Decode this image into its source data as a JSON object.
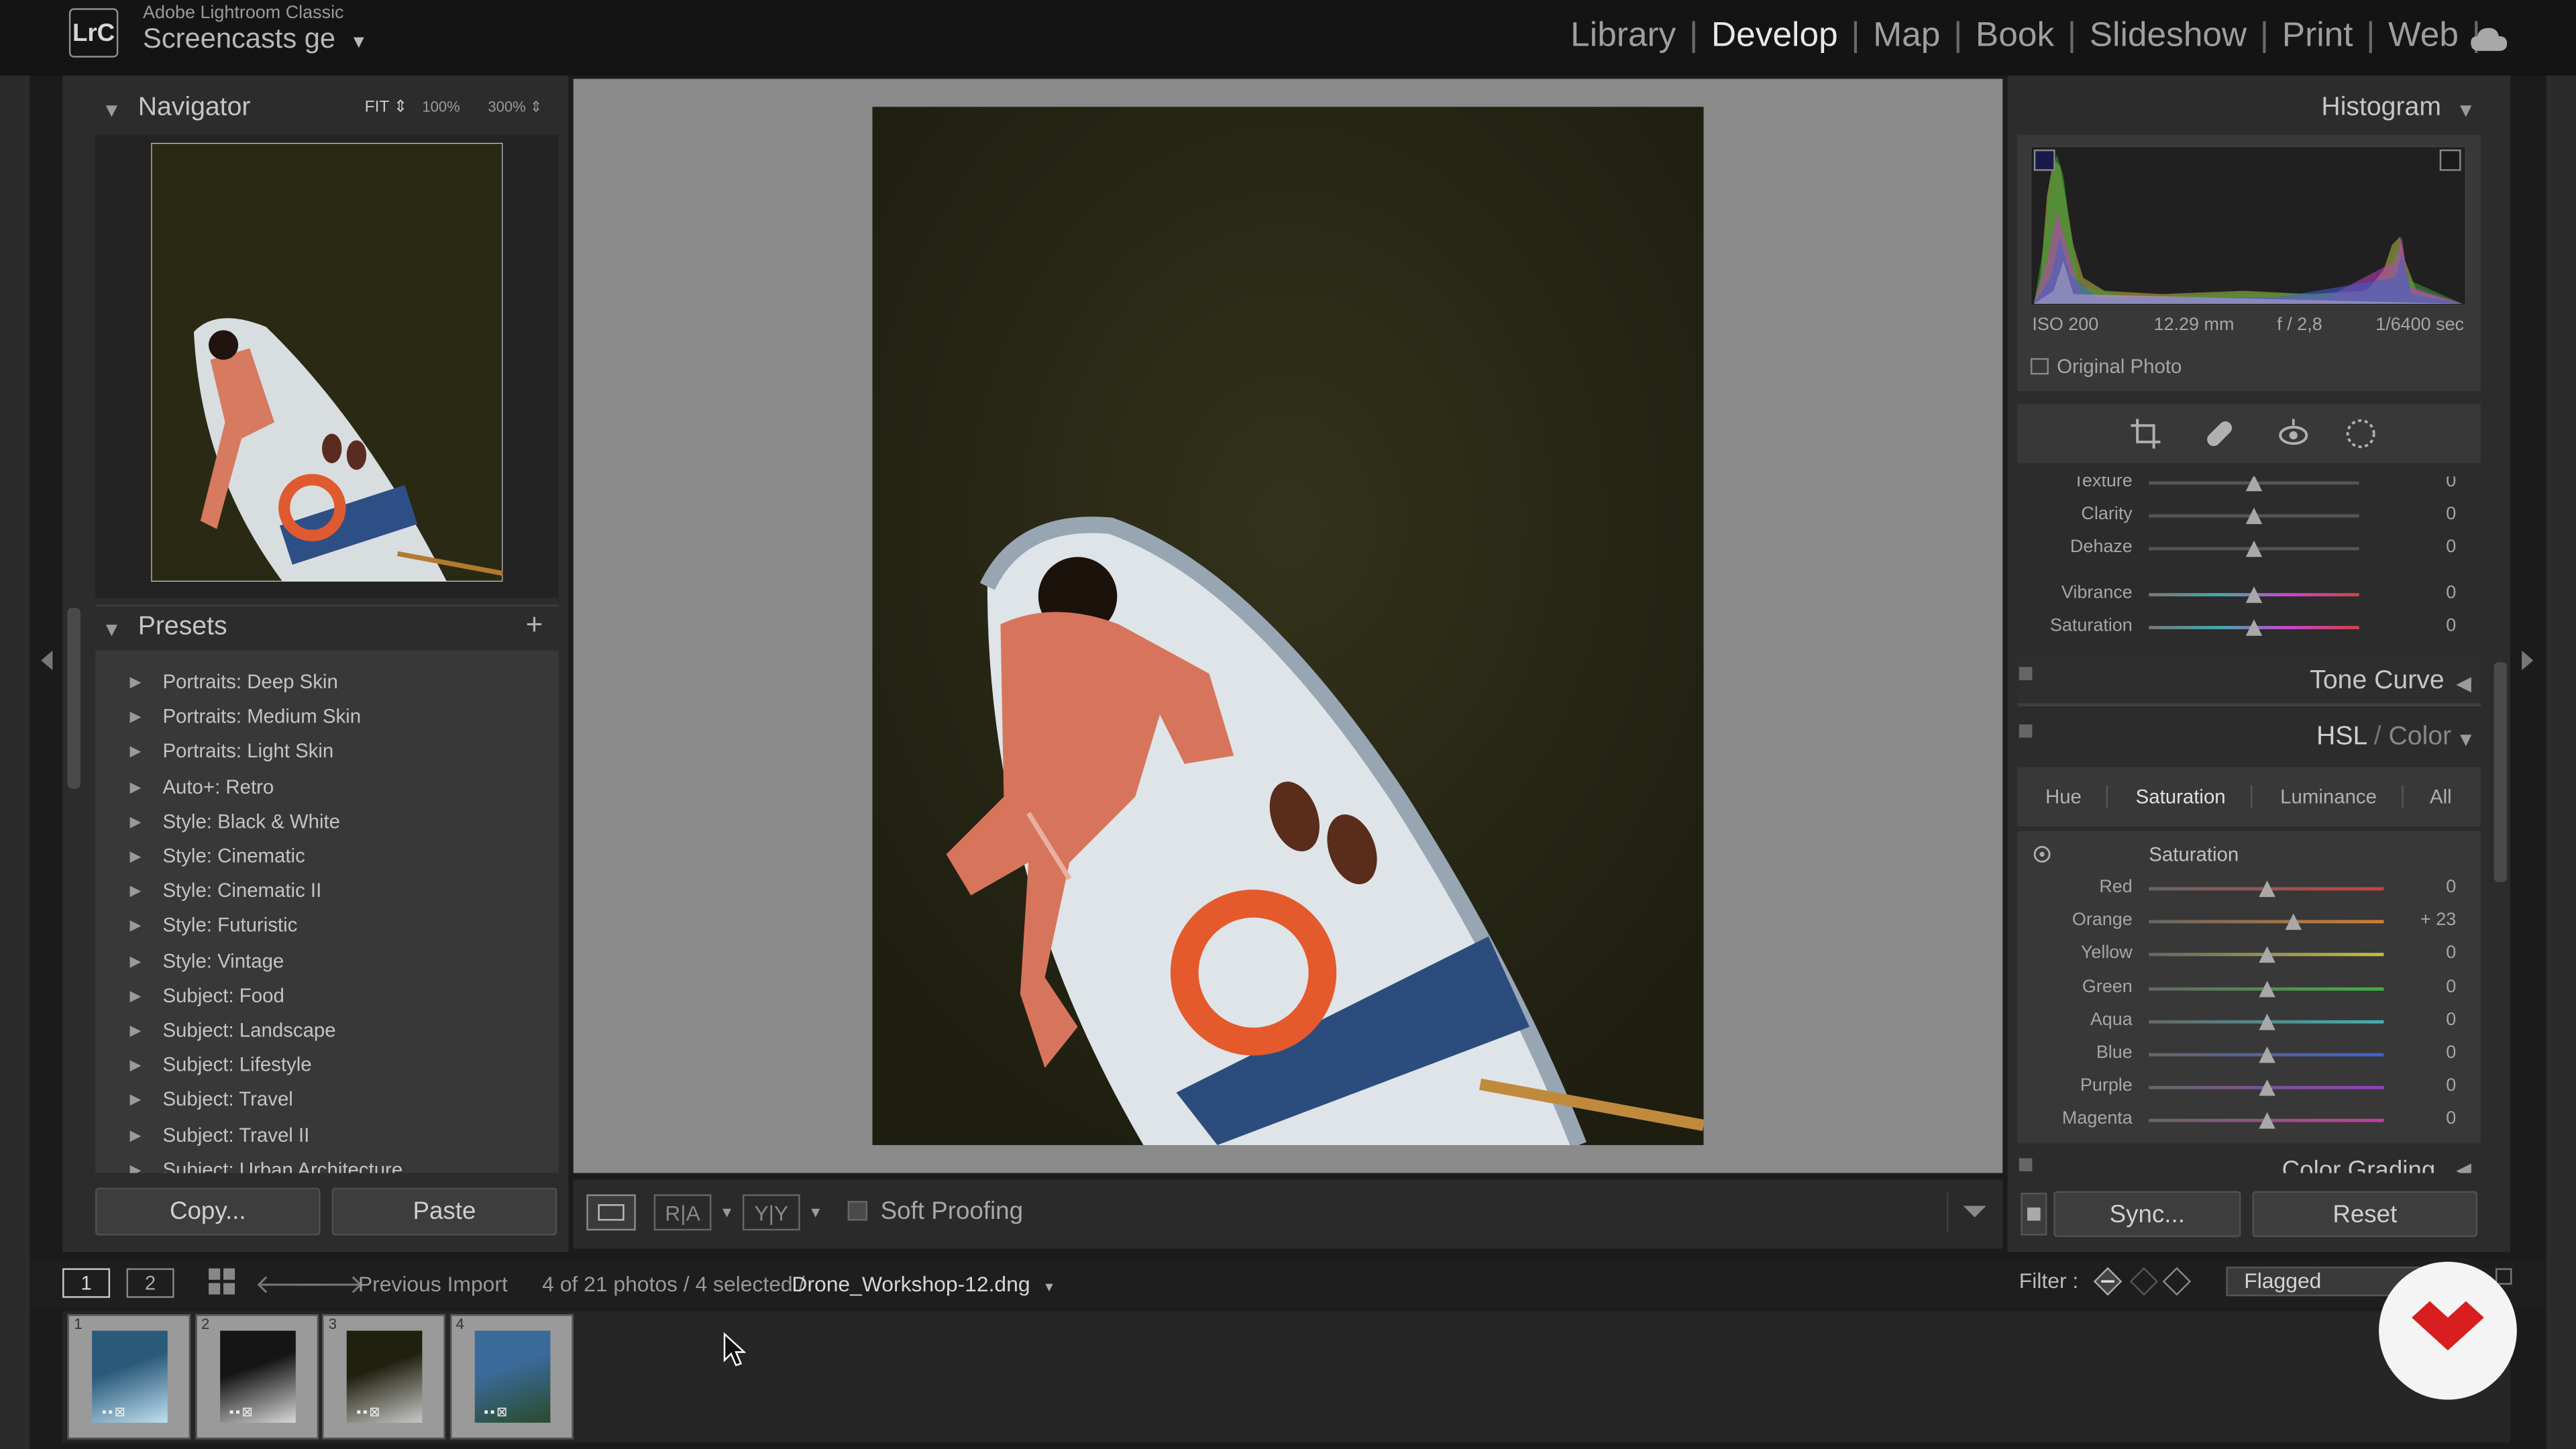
{
  "app": {
    "name": "Adobe Lightroom Classic",
    "logo": "LrC",
    "catalog": "Screencasts ge",
    "dropdown": "▼"
  },
  "modules": [
    "Library",
    "Develop",
    "Map",
    "Book",
    "Slideshow",
    "Print",
    "Web"
  ],
  "active_module": "Develop",
  "navigator": {
    "title": "Navigator",
    "fit": "FIT",
    "zoom100": "100%",
    "zoom300": "300%"
  },
  "presets": {
    "title": "Presets",
    "add": "+",
    "items": [
      "Portraits: Deep Skin",
      "Portraits: Medium Skin",
      "Portraits: Light Skin",
      "Auto+: Retro",
      "Style: Black & White",
      "Style: Cinematic",
      "Style: Cinematic II",
      "Style: Futuristic",
      "Style: Vintage",
      "Subject: Food",
      "Subject: Landscape",
      "Subject: Lifestyle",
      "Subject: Travel",
      "Subject: Travel II",
      "Subject: Urban Architecture"
    ]
  },
  "left_buttons": {
    "copy": "Copy...",
    "paste": "Paste"
  },
  "toolbar": {
    "soft_proofing": "Soft Proofing"
  },
  "histogram": {
    "title": "Histogram",
    "iso": "ISO 200",
    "focal": "12.29 mm",
    "aperture": "f / 2,8",
    "shutter": "1/6400 sec",
    "original_photo": "Original Photo"
  },
  "basic_sliders": [
    {
      "label": "Texture",
      "value": "0",
      "pos": 0.5
    },
    {
      "label": "Clarity",
      "value": "0",
      "pos": 0.5
    },
    {
      "label": "Dehaze",
      "value": "0",
      "pos": 0.5
    },
    {
      "label": "Vibrance",
      "value": "0",
      "pos": 0.5
    },
    {
      "label": "Saturation",
      "value": "0",
      "pos": 0.5
    }
  ],
  "tone_curve": {
    "title": "Tone Curve"
  },
  "hsl": {
    "title_hsl": "HSL",
    "title_slash": " / ",
    "title_color": "Color",
    "tabs": [
      "Hue",
      "Saturation",
      "Luminance",
      "All"
    ],
    "active_tab": "Saturation",
    "group": "Saturation",
    "sliders": [
      {
        "label": "Red",
        "value": "0",
        "pos": 0.5,
        "color": "#d04040"
      },
      {
        "label": "Orange",
        "value": "+ 23",
        "pos": 0.615,
        "color": "#d08030"
      },
      {
        "label": "Yellow",
        "value": "0",
        "pos": 0.5,
        "color": "#c8c040"
      },
      {
        "label": "Green",
        "value": "0",
        "pos": 0.5,
        "color": "#40b040"
      },
      {
        "label": "Aqua",
        "value": "0",
        "pos": 0.5,
        "color": "#40b0b0"
      },
      {
        "label": "Blue",
        "value": "0",
        "pos": 0.5,
        "color": "#4060d0"
      },
      {
        "label": "Purple",
        "value": "0",
        "pos": 0.5,
        "color": "#9040c0"
      },
      {
        "label": "Magenta",
        "value": "0",
        "pos": 0.5,
        "color": "#c040a0"
      }
    ]
  },
  "color_grading": {
    "title": "Color Grading"
  },
  "right_buttons": {
    "sync": "Sync...",
    "reset": "Reset"
  },
  "filmstrip_bar": {
    "view1": "1",
    "view2": "2",
    "source": "Previous Import",
    "count": "4 of 21 photos / 4 selected /",
    "filename": "Drone_Workshop-12.dng",
    "filter_label": "Filter :",
    "filter_value": "Flagged"
  },
  "filmstrip": {
    "thumbs": [
      "1",
      "2",
      "3",
      "4"
    ]
  }
}
